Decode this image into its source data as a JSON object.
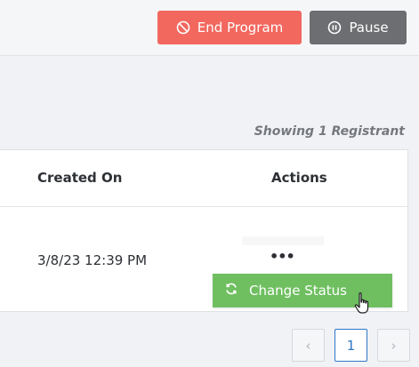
{
  "toolbar": {
    "end_program_label": "End Program",
    "end_program_icon": "ban-icon",
    "pause_label": "Pause",
    "pause_icon": "pause-circle-icon",
    "end_color": "#f2685f",
    "pause_color": "#6d6e71"
  },
  "registrants": {
    "showing_text": "Showing 1 Registrant",
    "columns": [
      "Created On",
      "Actions"
    ],
    "rows": [
      {
        "created_on": "3/8/23 12:39 PM",
        "actions_label": "•••"
      }
    ]
  },
  "actions_menu": {
    "items": [
      {
        "label": "Change Status",
        "icon": "refresh-icon",
        "color": "#6fbf61"
      }
    ]
  },
  "pagination": {
    "prev_label": "‹",
    "current_page": "1",
    "next_label": "›"
  }
}
